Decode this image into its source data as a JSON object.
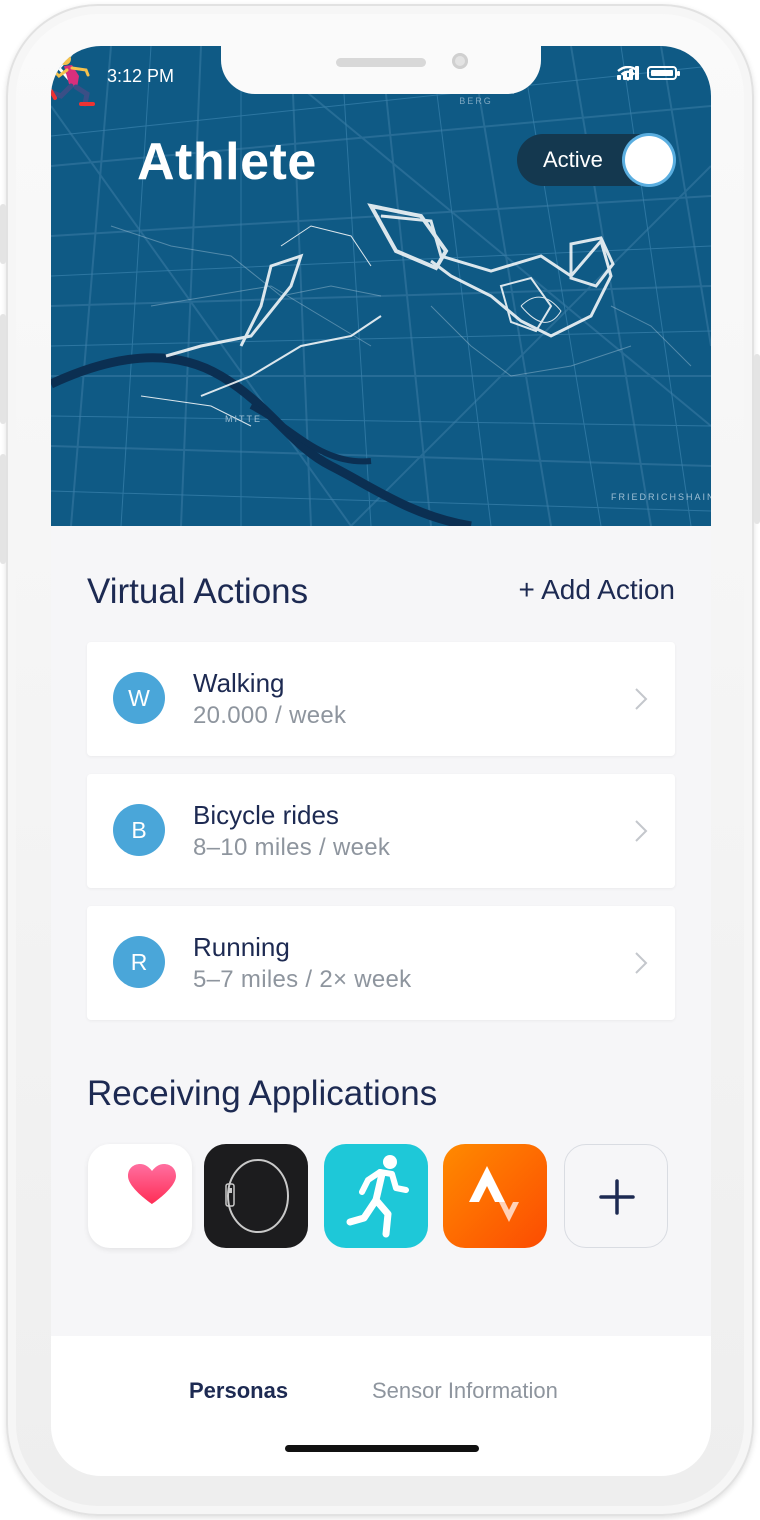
{
  "status_bar": {
    "time": "3:12 PM"
  },
  "header": {
    "title": "Athlete",
    "runner_emoji": "runner-emoji",
    "toggle": {
      "label": "Active",
      "on": true
    },
    "map_labels": [
      "PRENZLAUER BERG",
      "MITTE",
      "FRIEDRICHSHAIN"
    ],
    "colors": {
      "map_background": "#0f5a85",
      "toggle_bg": "#14384f",
      "toggle_ring": "#5aaee0"
    }
  },
  "virtual_actions": {
    "title": "Virtual Actions",
    "add_label": "+ Add Action",
    "items": [
      {
        "initial": "W",
        "name": "Walking",
        "detail": "20.000 / week"
      },
      {
        "initial": "B",
        "name": "Bicycle rides",
        "detail": "8–10 miles / week"
      },
      {
        "initial": "R",
        "name": "Running",
        "detail": "5–7 miles / 2× week"
      }
    ]
  },
  "receiving_applications": {
    "title": "Receiving Applications",
    "apps": [
      {
        "icon": "health-heart-icon",
        "color": "#ffffff"
      },
      {
        "icon": "watch-icon",
        "color": "#1c1c1e"
      },
      {
        "icon": "runner-app-icon",
        "color": "#1ec8d8"
      },
      {
        "icon": "strava-icon",
        "color": "#fc5200"
      },
      {
        "icon": "plus-icon",
        "color": "#f6f6f8"
      }
    ]
  },
  "tab_bar": {
    "tabs": [
      {
        "label": "Personas",
        "active": true
      },
      {
        "label": "Sensor Information",
        "active": false
      }
    ]
  },
  "colors": {
    "accent_dark": "#1d2a52",
    "avatar": "#4aa6d9",
    "muted_text": "#8e959e"
  }
}
